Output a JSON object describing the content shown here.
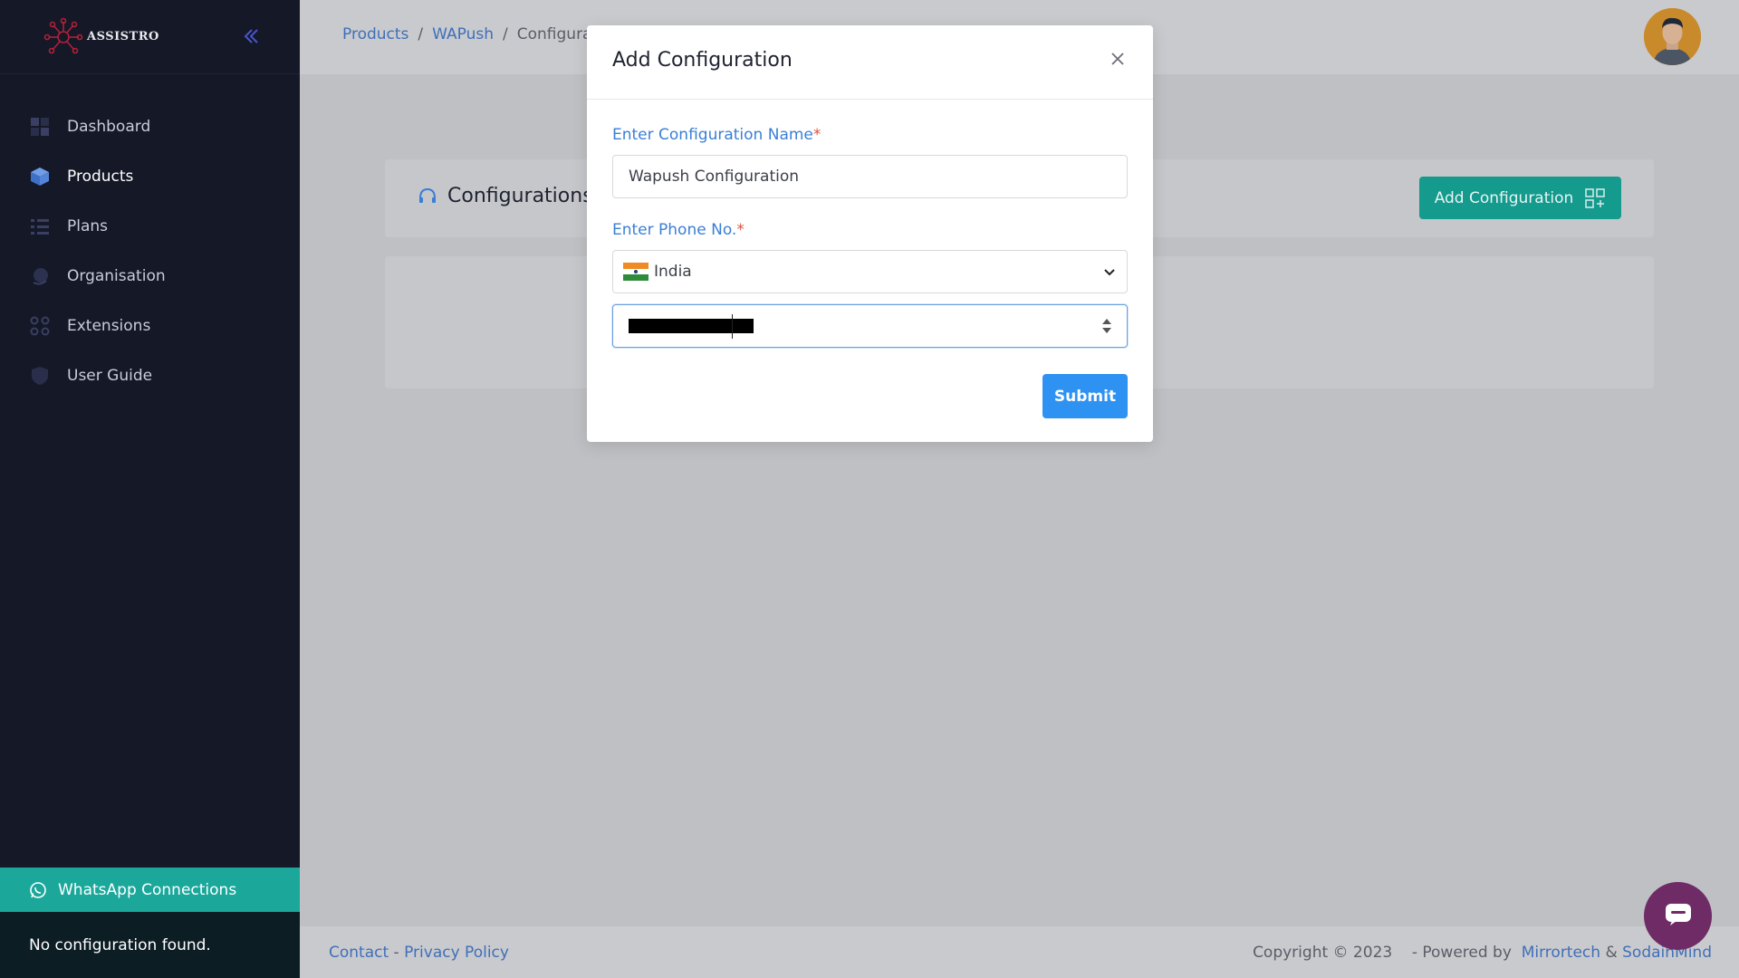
{
  "brand": {
    "name": "ASSISTRO"
  },
  "sidebar": {
    "items": [
      {
        "label": "Dashboard",
        "icon": "dashboard-icon"
      },
      {
        "label": "Products",
        "icon": "cube-icon"
      },
      {
        "label": "Plans",
        "icon": "list-icon"
      },
      {
        "label": "Organisation",
        "icon": "globe-icon"
      },
      {
        "label": "Extensions",
        "icon": "circles-icon"
      },
      {
        "label": "User Guide",
        "icon": "shield-icon"
      }
    ],
    "active": "Products",
    "whatsapp_label": "WhatsApp Connections",
    "status_text": "No configuration found."
  },
  "breadcrumb": {
    "items": [
      "Products",
      "WAPush",
      "Configurat"
    ]
  },
  "main": {
    "card_title": "Configurations",
    "add_button_label": "Add Configuration"
  },
  "footer": {
    "contact": "Contact",
    "dash": "-",
    "privacy": "Privacy Policy",
    "copyright": "Copyright © 2023",
    "powered_by": "- Powered by",
    "mirrortech": "Mirrortech",
    "amp": "&",
    "sodainmind": "SodainMind"
  },
  "modal": {
    "title": "Add Configuration",
    "name_label": "Enter Configuration Name",
    "name_value": "Wapush Configuration",
    "phone_label": "Enter Phone No.",
    "required_mark": "*",
    "country": "India",
    "submit_label": "Submit"
  },
  "colors": {
    "sidebar_bg": "#141827",
    "accent_teal": "#1ba89b",
    "primary_blue": "#2e92f2",
    "link_blue": "#3f6fb8",
    "label_blue": "#3a7fd5",
    "required_red": "#e0523f"
  }
}
